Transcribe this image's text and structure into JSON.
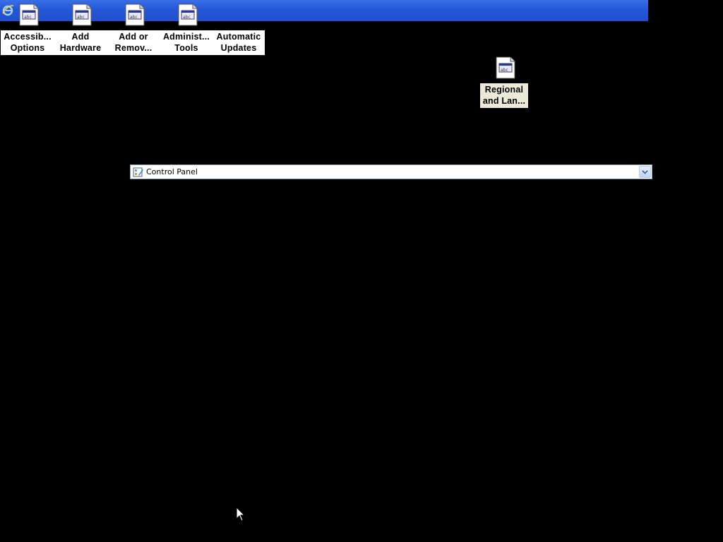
{
  "desktop": {
    "items": [
      {
        "label_line1": "Accessib...",
        "label_line2": "Options"
      },
      {
        "label_line1": "Add",
        "label_line2": "Hardware"
      },
      {
        "label_line1": "Add or",
        "label_line2": "Remov..."
      },
      {
        "label_line1": "Administ...",
        "label_line2": "Tools"
      },
      {
        "label_line1": "Automatic",
        "label_line2": "Updates"
      },
      {
        "label_line1": "Regional",
        "label_line2": "and Lan..."
      }
    ]
  },
  "address_bar": {
    "text": "Control Panel",
    "icon": "control-panel-icon"
  },
  "colors": {
    "titlebar": "#2457d6",
    "background": "#000000",
    "label_bg": "#ffffff",
    "selected_label_bg": "#ece9d8"
  }
}
